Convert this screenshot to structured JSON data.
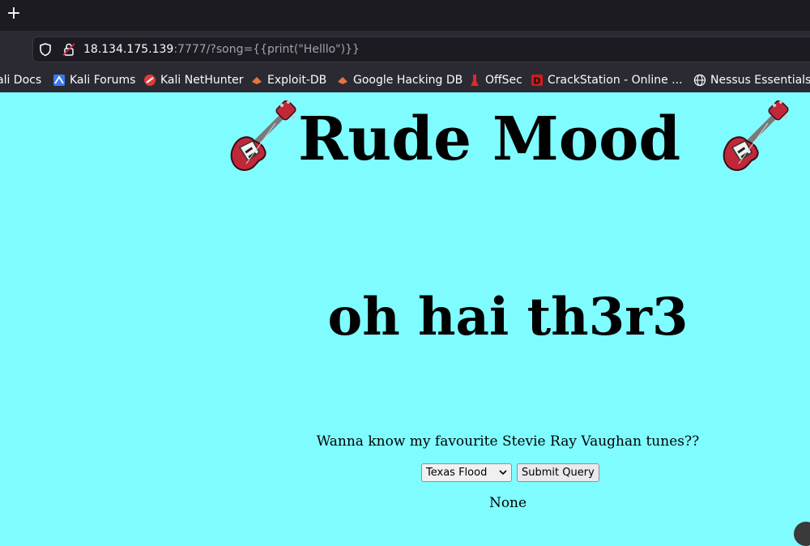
{
  "browser": {
    "new_tab_label": "+",
    "url_host": "18.134.175.139",
    "url_rest": ":7777/?song={{print(\"Helllo\")}}",
    "bookmarks": [
      {
        "label": "ali Docs",
        "icon": "none"
      },
      {
        "label": "Kali Forums",
        "icon": "kali-forums-icon"
      },
      {
        "label": "Kali NetHunter",
        "icon": "nethunter-icon"
      },
      {
        "label": "Exploit-DB",
        "icon": "exploit-db-icon"
      },
      {
        "label": "Google Hacking DB",
        "icon": "ghdb-icon"
      },
      {
        "label": "OffSec",
        "icon": "offsec-icon"
      },
      {
        "label": "CrackStation - Online ...",
        "icon": "crackstation-icon"
      },
      {
        "label": "Nessus Essentials",
        "icon": "globe-icon"
      }
    ]
  },
  "page": {
    "title": "Rude Mood",
    "subtitle": "oh hai th3r3",
    "question": "Wanna know my favourite Stevie Ray Vaughan tunes??",
    "select_value": "Texas Flood",
    "submit_label": "Submit Query",
    "result": "None"
  },
  "colors": {
    "page_bg": "#7ffcff",
    "chrome_dark": "#1c1b22",
    "chrome_mid": "#2b2a33",
    "guitar_body": "#c0283a"
  }
}
